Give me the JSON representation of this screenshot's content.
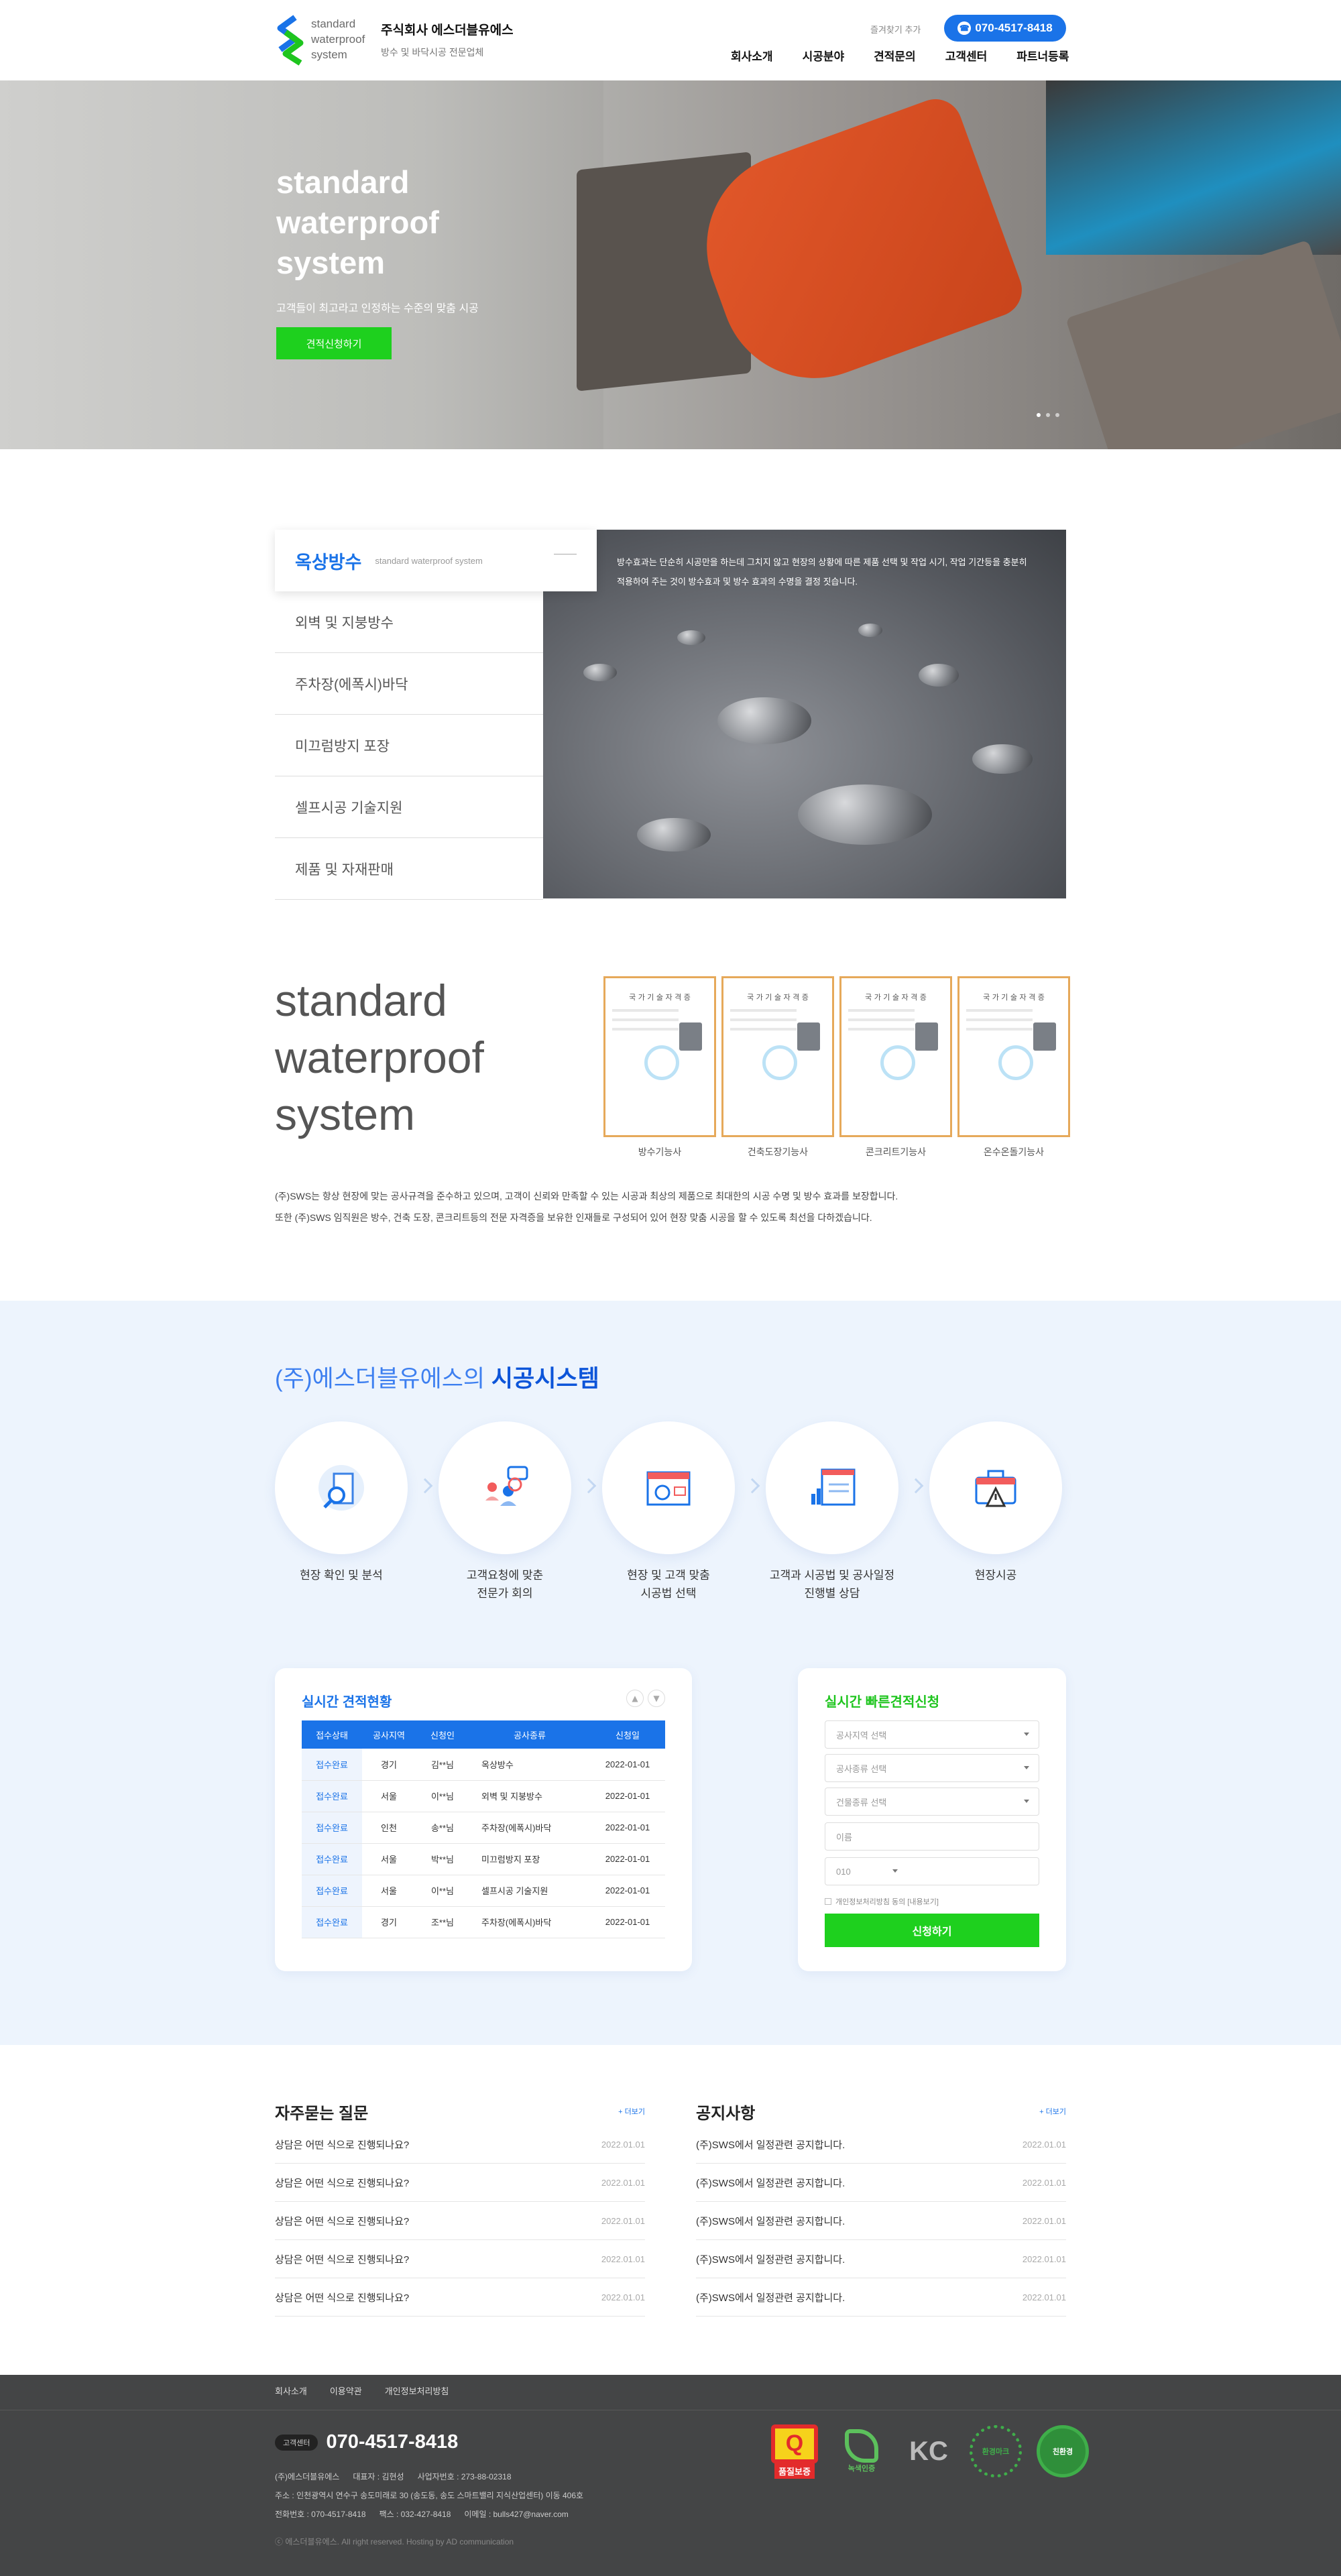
{
  "header": {
    "logo_words": [
      "standard",
      "waterproof",
      "system"
    ],
    "company_name": "주식회사 에스더블유에스",
    "company_sub": "방수 및 바닥시공 전문업체",
    "favorite": "즐겨찾기 추가",
    "phone": "070-4517-8418",
    "nav": [
      "회사소개",
      "시공분야",
      "견적문의",
      "고객센터",
      "파트너등록"
    ]
  },
  "hero": {
    "title": "standard waterproof system",
    "subtitle": "고객들이 최고라고 인정하는 수준의 맞춤 시공",
    "button": "견적신청하기"
  },
  "services": {
    "active_title": "옥상방수",
    "active_sub": "standard waterproof system",
    "items": [
      "외벽 및 지붕방수",
      "주차장(에폭시)바닥",
      "미끄럼방지 포장",
      "셀프시공 기술지원",
      "제품 및 자재판매"
    ],
    "description": "방수효과는 단순히 시공만을 하는데 그치지 않고 현장의 상황에 따른 제품 선택 및 작업 시기, 작업 기간등을 충분히 적용하여 주는 것이 방수효과 및 방수 효과의 수명을 결정 짓습니다."
  },
  "about": {
    "title_lines": [
      "standard",
      "waterproof",
      "system"
    ],
    "cert_header": "국 가 기 술 자 격 증",
    "certificates": [
      "방수기능사",
      "건축도장기능사",
      "콘크리트기능사",
      "온수온돌기능사"
    ],
    "text_1": "(주)SWS는 항상 현장에 맞는 공사규격을 준수하고 있으며, 고객이 신뢰와 만족할 수 있는 시공과 최상의 제품으로 최대한의 시공 수명 및 방수 효과를 보장합니다.",
    "text_2": "또한 (주)SWS 임직원은 방수, 건축 도장, 콘크리트등의 전문 자격증을 보유한 인재들로 구성되어 있어 현장 맞춤 시공을 할 수 있도록 최선을 다하겠습니다."
  },
  "process": {
    "title_prefix": "(주)에스더블유에스의",
    "title_bold": "시공시스템",
    "steps": [
      {
        "label": "현장 확인 및 분석",
        "icon": "building-search-icon"
      },
      {
        "label": "고객요청에 맞춘\n전문가 회의",
        "icon": "meeting-chat-icon"
      },
      {
        "label": "현장 및 고객 맞춤\n시공법 선택",
        "icon": "calendar-plan-icon"
      },
      {
        "label": "고객과 시공법 및 공사일정\n진행별 상담",
        "icon": "chart-board-icon"
      },
      {
        "label": "현장시공",
        "icon": "toolbox-warning-icon"
      }
    ]
  },
  "status_board": {
    "title": "실시간 견적현황",
    "headers": [
      "접수상태",
      "공사지역",
      "신청인",
      "공사종류",
      "신청일"
    ],
    "rows": [
      [
        "접수완료",
        "경기",
        "김**님",
        "옥상방수",
        "2022-01-01"
      ],
      [
        "접수완료",
        "서울",
        "이**님",
        "외벽 및 지붕방수",
        "2022-01-01"
      ],
      [
        "접수완료",
        "인천",
        "송**님",
        "주차장(에폭시)바닥",
        "2022-01-01"
      ],
      [
        "접수완료",
        "서울",
        "박**님",
        "미끄럼방지 포장",
        "2022-01-01"
      ],
      [
        "접수완료",
        "서울",
        "이**님",
        "셀프시공 기술지원",
        "2022-01-01"
      ],
      [
        "접수완료",
        "경기",
        "조**님",
        "주차장(에폭시)바닥",
        "2022-01-01"
      ]
    ]
  },
  "quote_form": {
    "title": "실시간 빠른견적신청",
    "region": "공사지역 선택",
    "work_type": "공사종류 선택",
    "building_type": "건물종류 선택",
    "name": "이름",
    "phone_prefix": "010",
    "agree": "개인정보처리방침 동의 [내용보기]",
    "submit": "신청하기"
  },
  "faq": {
    "title": "자주묻는 질문",
    "more": "+ 더보기",
    "items": [
      {
        "q": "상담은 어떤 식으로 진행되나요?",
        "date": "2022.01.01"
      },
      {
        "q": "상담은 어떤 식으로 진행되나요?",
        "date": "2022.01.01"
      },
      {
        "q": "상담은 어떤 식으로 진행되나요?",
        "date": "2022.01.01"
      },
      {
        "q": "상담은 어떤 식으로 진행되나요?",
        "date": "2022.01.01"
      },
      {
        "q": "상담은 어떤 식으로 진행되나요?",
        "date": "2022.01.01"
      }
    ]
  },
  "notice": {
    "title": "공지사항",
    "more": "+ 더보기",
    "items": [
      {
        "q": "(주)SWS에서 일정관련 공지합니다.",
        "date": "2022.01.01"
      },
      {
        "q": "(주)SWS에서 일정관련 공지합니다.",
        "date": "2022.01.01"
      },
      {
        "q": "(주)SWS에서 일정관련 공지합니다.",
        "date": "2022.01.01"
      },
      {
        "q": "(주)SWS에서 일정관련 공지합니다.",
        "date": "2022.01.01"
      },
      {
        "q": "(주)SWS에서 일정관련 공지합니다.",
        "date": "2022.01.01"
      }
    ]
  },
  "footer": {
    "links": [
      "회사소개",
      "이용약관",
      "개인정보처리방침"
    ],
    "cs_tag": "고객센터",
    "cs_phone": "070-4517-8418",
    "info_1": "(주)에스더블유에스      대표자 : 김현성      사업자번호 : 273-88-02318",
    "info_2": "주소 : 인천광역시 연수구 송도미래로 30 (송도동, 송도 스마트밸리 지식산업센터) 이동 406호",
    "info_3": "전화번호 : 070-4517-8418      팩스 : 032-427-8418      이메일 : bulls427@naver.com",
    "copyright": "ⓒ 에스더블유에스. All right reserved. Hosting by AD communication",
    "badges": [
      "품질보증",
      "녹색인증",
      "KC",
      "환경마크",
      "친환경"
    ]
  }
}
